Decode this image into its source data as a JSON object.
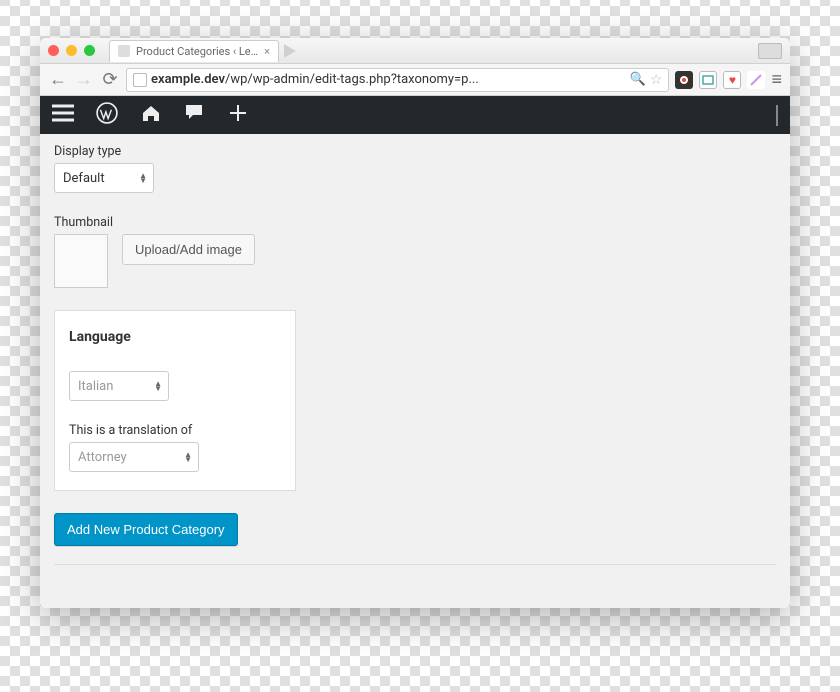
{
  "browser": {
    "tab_title": "Product Categories ‹ Legal",
    "url_host": "example.dev",
    "url_path": "/wp/wp-admin/edit-tags.php?taxonomy=p..."
  },
  "form": {
    "display_type": {
      "label": "Display type",
      "value": "Default"
    },
    "thumbnail": {
      "label": "Thumbnail",
      "button": "Upload/Add image"
    },
    "language_panel": {
      "title": "Language",
      "language_value": "Italian",
      "translation_label": "This is a translation of",
      "translation_value": "Attorney"
    },
    "submit": "Add New Product Category"
  }
}
